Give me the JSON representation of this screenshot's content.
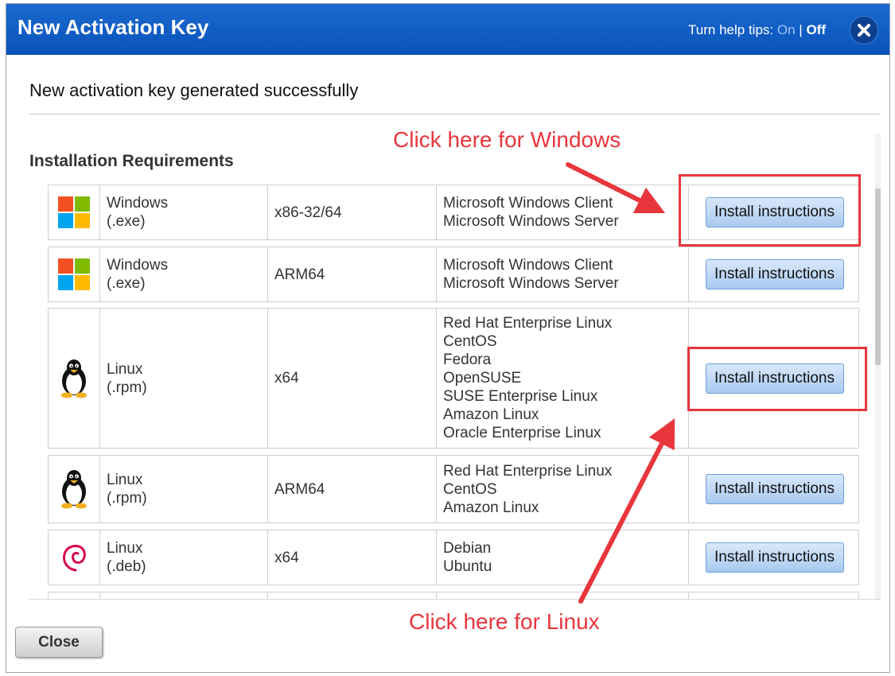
{
  "dialog": {
    "title": "New Activation Key",
    "help_tips_label": "Turn help tips:",
    "help_on": "On",
    "help_separator": "|",
    "help_off": "Off",
    "close_icon": "close-icon"
  },
  "main": {
    "success_message": "New activation key generated successfully",
    "section_title": "Installation Requirements",
    "rows": [
      {
        "icon": "windows-logo-icon",
        "platform": "Windows",
        "package": "(.exe)",
        "arch": "x86-32/64",
        "os": [
          "Microsoft Windows Client",
          "Microsoft Windows Server"
        ],
        "button": "Install instructions"
      },
      {
        "icon": "windows-logo-icon",
        "platform": "Windows",
        "package": "(.exe)",
        "arch": "ARM64",
        "os": [
          "Microsoft Windows Client",
          "Microsoft Windows Server"
        ],
        "button": "Install instructions"
      },
      {
        "icon": "linux-tux-icon",
        "platform": "Linux",
        "package": "(.rpm)",
        "arch": "x64",
        "os": [
          "Red Hat Enterprise Linux",
          "CentOS",
          "Fedora",
          "OpenSUSE",
          "SUSE Enterprise Linux",
          "Amazon Linux",
          "Oracle Enterprise Linux"
        ],
        "button": "Install instructions"
      },
      {
        "icon": "linux-tux-icon",
        "platform": "Linux",
        "package": "(.rpm)",
        "arch": "ARM64",
        "os": [
          "Red Hat Enterprise Linux",
          "CentOS",
          "Amazon Linux"
        ],
        "button": "Install instructions"
      },
      {
        "icon": "debian-swirl-icon",
        "platform": "Linux",
        "package": "(.deb)",
        "arch": "x64",
        "os": [
          "Debian",
          "Ubuntu"
        ],
        "button": "Install instructions"
      }
    ]
  },
  "footer": {
    "close_label": "Close"
  },
  "annotations": {
    "windows_callout": "Click here for Windows",
    "linux_callout": "Click here for Linux",
    "color": "#e8363d"
  },
  "colors": {
    "titlebar": "#0a52b9",
    "button": "#a9c9ef"
  }
}
